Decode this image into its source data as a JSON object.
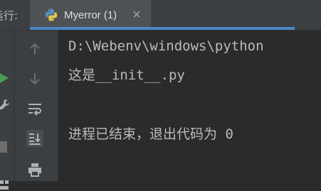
{
  "run_panel": {
    "label": "运行:",
    "tab": {
      "title": "Myerror (1)",
      "close_icon": "close-icon"
    }
  },
  "console": {
    "lines": [
      "D:\\Webenv\\windows\\python",
      "这是__init__.py",
      "",
      "进程已结束，退出代码为 0"
    ]
  },
  "toolbar": {
    "icons": [
      "run-icon",
      "wrench-icon",
      "stop-icon",
      "layout-icon",
      "arrow-up-icon",
      "arrow-down-icon",
      "soft-wrap-icon",
      "scroll-to-end-icon",
      "print-icon"
    ]
  },
  "colors": {
    "accent": "#4a88c7",
    "background": "#2b2b2b",
    "panel": "#3c3f41",
    "run_green": "#499c54"
  }
}
